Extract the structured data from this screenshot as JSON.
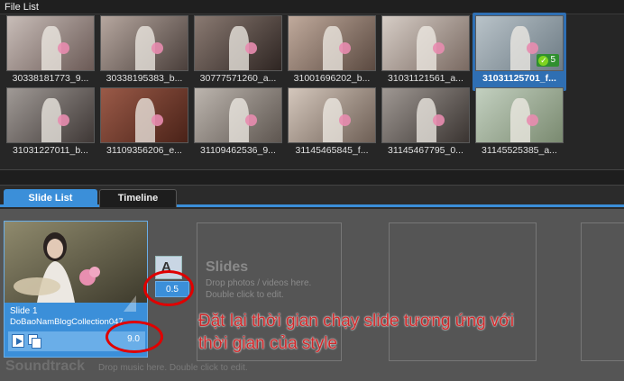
{
  "file_list": {
    "title": "File List",
    "items": [
      {
        "caption": "30338181773_9...",
        "tone": [
          "#c8bdb8",
          "#6b5a56"
        ]
      },
      {
        "caption": "30338195383_b...",
        "tone": [
          "#b6a79f",
          "#4a3f3b"
        ]
      },
      {
        "caption": "30777571260_a...",
        "tone": [
          "#8a7a72",
          "#2e2522"
        ]
      },
      {
        "caption": "31001696202_b...",
        "tone": [
          "#c0aa9c",
          "#5b4a41"
        ]
      },
      {
        "caption": "31031121561_a...",
        "tone": [
          "#d6cdc6",
          "#7a6a62"
        ]
      },
      {
        "caption": "31031125701_f...",
        "tone": [
          "#b9c3c9",
          "#6d7b84"
        ],
        "selected": true,
        "badge": "5"
      },
      {
        "caption": "31031227011_b...",
        "tone": [
          "#a09a96",
          "#3f3836"
        ]
      },
      {
        "caption": "31109356206_e...",
        "tone": [
          "#9a5a48",
          "#4a2218"
        ]
      },
      {
        "caption": "31109462536_9...",
        "tone": [
          "#bcb5ae",
          "#5e5650"
        ]
      },
      {
        "caption": "31145465845_f...",
        "tone": [
          "#d4c7bc",
          "#6e5f55"
        ]
      },
      {
        "caption": "31145467795_0...",
        "tone": [
          "#9f9893",
          "#3a3431"
        ]
      },
      {
        "caption": "31145525385_a...",
        "tone": [
          "#c3d0c0",
          "#7a8a70"
        ]
      }
    ]
  },
  "tabs": {
    "slide_list": "Slide List",
    "timeline": "Timeline"
  },
  "slide": {
    "name": "Slide 1",
    "file": "DoBaoNamBlogCollection047",
    "duration": "9.0",
    "transition_duration": "0.5",
    "transition_icon_letter": "A"
  },
  "placeholder": {
    "title": "Slides",
    "hint1": "Drop photos / videos here.",
    "hint2": "Double click to edit."
  },
  "soundtrack": {
    "title": "Soundtrack",
    "hint": "Drop music here.  Double click to edit."
  },
  "annotation": {
    "line1": "Đặt lại thời gian chạy slide tương ứng với",
    "line2": "thời gian của style"
  },
  "colors": {
    "accent": "#3b8fd9",
    "annotation": "#d0282a",
    "highlight_circle": "#e00000"
  },
  "icons": {
    "play": "play-icon",
    "copy": "copy-icon",
    "transition": "transition-icon",
    "check": "check-icon"
  }
}
